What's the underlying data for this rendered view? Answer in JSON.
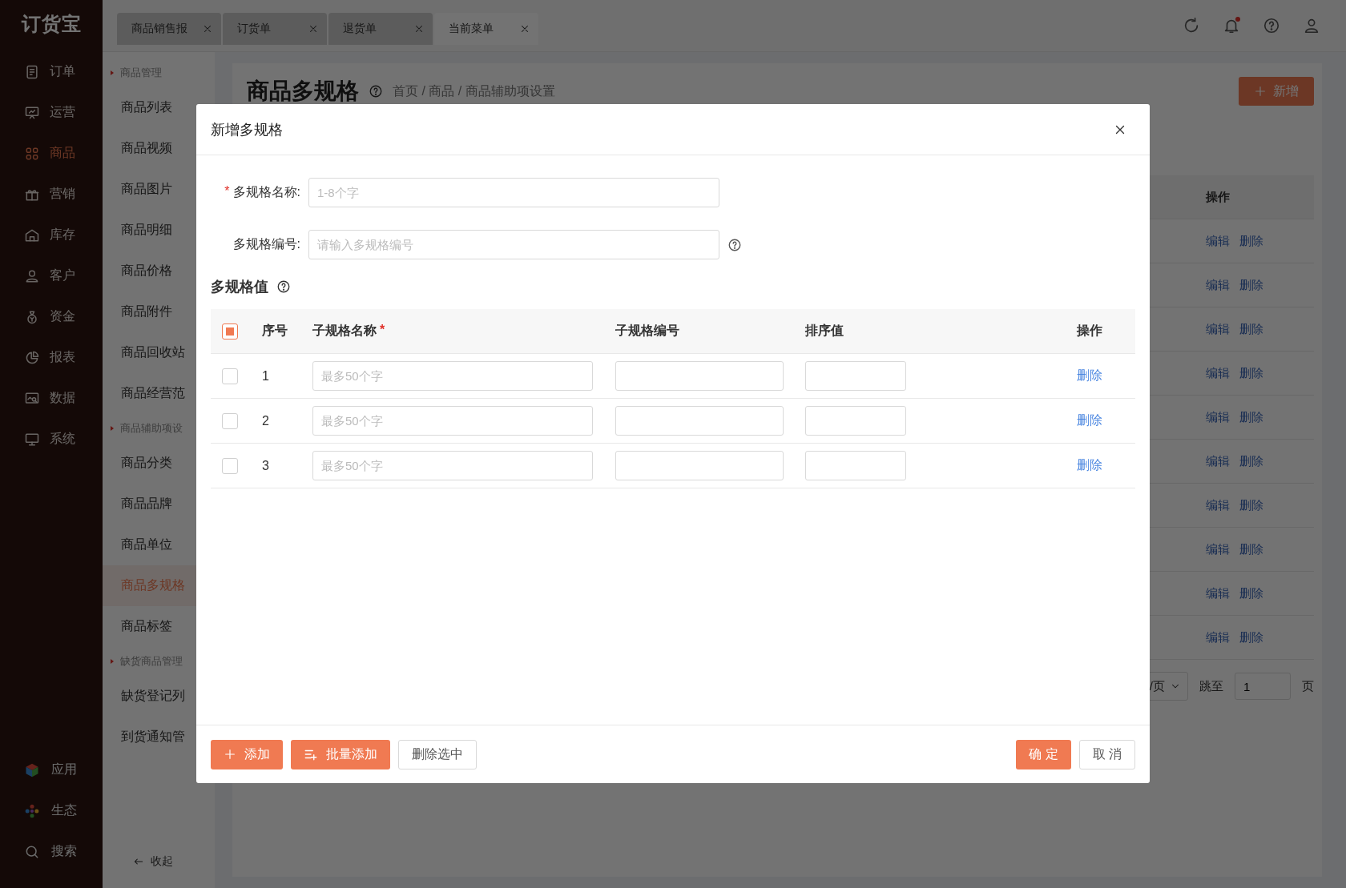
{
  "logo": "订货宝",
  "main_nav": [
    {
      "label": "订单",
      "selected": false
    },
    {
      "label": "运营",
      "selected": false
    },
    {
      "label": "商品",
      "selected": true
    },
    {
      "label": "营销",
      "selected": false
    },
    {
      "label": "库存",
      "selected": false
    },
    {
      "label": "客户",
      "selected": false
    },
    {
      "label": "资金",
      "selected": false
    },
    {
      "label": "报表",
      "selected": false
    },
    {
      "label": "数据",
      "selected": false
    },
    {
      "label": "系统",
      "selected": false
    }
  ],
  "bottom_nav": [
    {
      "label": "应用"
    },
    {
      "label": "生态"
    },
    {
      "label": "搜索"
    }
  ],
  "tabs": [
    {
      "label": "商品销售报",
      "selected": false
    },
    {
      "label": "订货单",
      "selected": false
    },
    {
      "label": "退货单",
      "selected": false
    },
    {
      "label": "当前菜单",
      "selected": true
    }
  ],
  "sub_nav": [
    {
      "kind": "section",
      "label": "商品管理"
    },
    {
      "kind": "item",
      "label": "商品列表",
      "selected": false
    },
    {
      "kind": "item",
      "label": "商品视频",
      "selected": false
    },
    {
      "kind": "item",
      "label": "商品图片",
      "selected": false
    },
    {
      "kind": "item",
      "label": "商品明细",
      "selected": false
    },
    {
      "kind": "item",
      "label": "商品价格",
      "selected": false
    },
    {
      "kind": "item",
      "label": "商品附件",
      "selected": false
    },
    {
      "kind": "item",
      "label": "商品回收站",
      "selected": false
    },
    {
      "kind": "item",
      "label": "商品经营范",
      "selected": false
    },
    {
      "kind": "section",
      "label": "商品辅助项设"
    },
    {
      "kind": "item",
      "label": "商品分类",
      "selected": false
    },
    {
      "kind": "item",
      "label": "商品品牌",
      "selected": false
    },
    {
      "kind": "item",
      "label": "商品单位",
      "selected": false
    },
    {
      "kind": "item",
      "label": "商品多规格",
      "selected": true
    },
    {
      "kind": "item",
      "label": "商品标签",
      "selected": false
    },
    {
      "kind": "section",
      "label": "缺货商品管理"
    },
    {
      "kind": "item",
      "label": "缺货登记列",
      "selected": false
    },
    {
      "kind": "item",
      "label": "到货通知管",
      "selected": false
    }
  ],
  "collapse": "收起",
  "page": {
    "title": "商品多规格",
    "breadcrumb": "首页 / 商品 / 商品辅助项设置",
    "add_button": "新增"
  },
  "table": {
    "action_header": "操作",
    "rows": [
      {
        "edit": "编辑",
        "delete": "删除"
      },
      {
        "edit": "编辑",
        "delete": "删除"
      },
      {
        "edit": "编辑",
        "delete": "删除"
      },
      {
        "edit": "编辑",
        "delete": "删除"
      },
      {
        "edit": "编辑",
        "delete": "删除"
      },
      {
        "edit": "编辑",
        "delete": "删除"
      },
      {
        "edit": "编辑",
        "delete": "删除"
      },
      {
        "edit": "编辑",
        "delete": "删除"
      },
      {
        "edit": "编辑",
        "delete": "删除"
      },
      {
        "edit": "编辑",
        "delete": "删除"
      }
    ]
  },
  "pagination": {
    "page_size": "/页",
    "jump_label": "跳至",
    "jump_value": "1",
    "page_unit": "页"
  },
  "dialog": {
    "title": "新增多规格",
    "fields": [
      {
        "required_mark": "*",
        "label": "多规格名称:",
        "placeholder": "1-8个字",
        "help": false
      },
      {
        "label": "多规格编号:",
        "placeholder": "请输入多规格编号",
        "help": true
      }
    ],
    "section_title": "多规格值",
    "table": {
      "header_checkbox": {
        "indeterminate": true
      },
      "columns": [
        {
          "label": "序号"
        },
        {
          "label": "子规格名称",
          "required_mark": "*"
        },
        {
          "label": "子规格编号"
        },
        {
          "label": "排序值"
        },
        {
          "label": "操作"
        }
      ],
      "rows": [
        {
          "checked": false,
          "index": "1",
          "name_placeholder": "最多50个字",
          "delete": "删除"
        },
        {
          "checked": false,
          "index": "2",
          "name_placeholder": "最多50个字",
          "delete": "删除"
        },
        {
          "checked": false,
          "index": "3",
          "name_placeholder": "最多50个字",
          "delete": "删除"
        }
      ]
    },
    "left_buttons": [
      {
        "kind": "add",
        "label": "添加"
      },
      {
        "kind": "batch",
        "label": "批量添加"
      },
      {
        "kind": "plain",
        "label": "删除选中"
      }
    ],
    "right_buttons": [
      {
        "kind": "primary",
        "label": "确 定"
      },
      {
        "kind": "plain",
        "label": "取 消"
      }
    ]
  }
}
